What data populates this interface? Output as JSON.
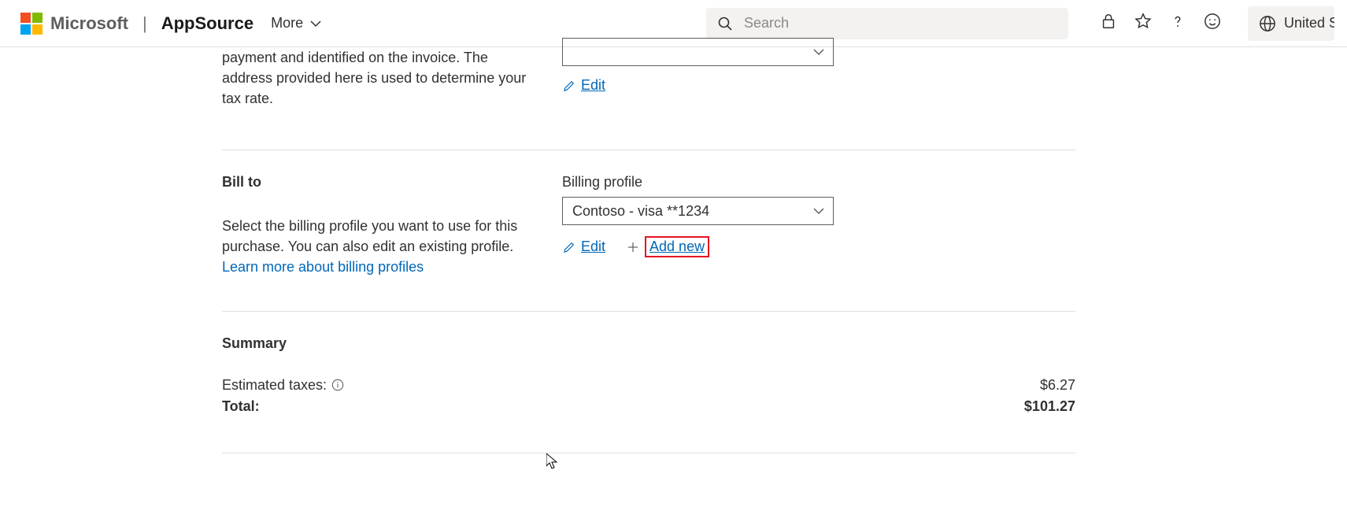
{
  "header": {
    "ms": "Microsoft",
    "brand": "AppSource",
    "more": "More",
    "search_placeholder": "Search",
    "region": "United Stat"
  },
  "sold_to": {
    "desc_frag": "payment and identified on the invoice. The address provided here is used to determine your tax rate.",
    "edit": "Edit"
  },
  "bill_to": {
    "title": "Bill to",
    "desc": "Select the billing profile you want to use for this purchase. You can also edit an existing profile. ",
    "learn": "Learn more about billing profiles",
    "profile_label": "Billing profile",
    "profile_value": "Contoso - visa **1234",
    "edit": "Edit",
    "add_new": "Add new"
  },
  "summary": {
    "title": "Summary",
    "taxes_label": "Estimated taxes:",
    "taxes_value": "$6.27",
    "total_label": "Total:",
    "total_value": "$101.27"
  }
}
